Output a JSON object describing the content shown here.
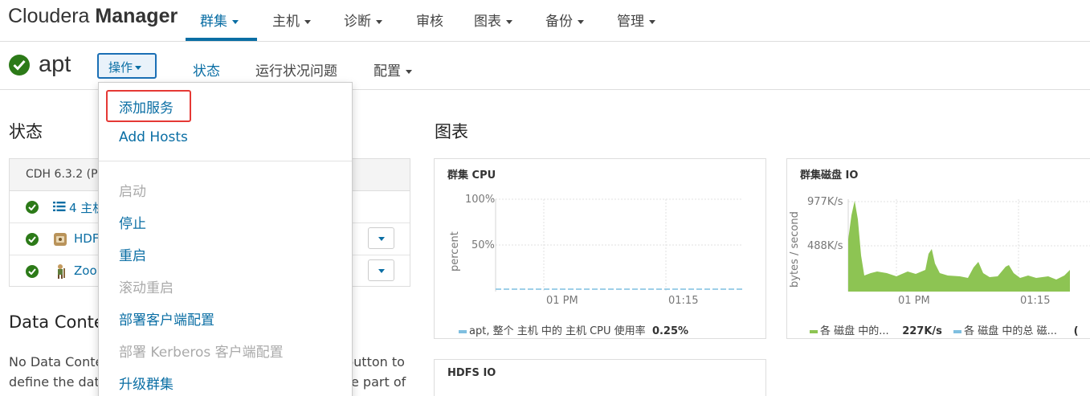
{
  "app": {
    "brand_light": "Cloudera",
    "brand_bold": "Manager"
  },
  "topnav": {
    "items": [
      {
        "label": "群集",
        "active": true
      },
      {
        "label": "主机"
      },
      {
        "label": "诊断"
      },
      {
        "label": "审核"
      },
      {
        "label": "图表"
      },
      {
        "label": "备份"
      },
      {
        "label": "管理"
      }
    ]
  },
  "cluster": {
    "name": "apt",
    "actions_label": "操作",
    "tabs": [
      {
        "label": "状态"
      },
      {
        "label": "运行状况问题"
      },
      {
        "label": "配置"
      }
    ]
  },
  "status": {
    "heading": "状态",
    "version": "CDH 6.3.2 (P",
    "rows": [
      {
        "label": "4 主机",
        "icon": "list-icon"
      },
      {
        "label": "HDF",
        "icon": "hdfs-icon"
      },
      {
        "label": "Zoo",
        "icon": "zookeeper-icon"
      }
    ]
  },
  "data_context": {
    "heading": "Data Conte",
    "line1_left": "No Data Conte",
    "line1_right": "button to",
    "line2_left": "define the data",
    "line2_right": "e part of"
  },
  "charts": {
    "heading": "图表",
    "cpu": {
      "title": "群集 CPU",
      "ylabel": "percent",
      "yticks": [
        "100%",
        "50%"
      ],
      "xticks": [
        "01 PM",
        "01:15"
      ],
      "legend_label": "apt, 整个 主机 中的 主机 CPU 使用率",
      "legend_value": "0.25%"
    },
    "disk": {
      "title": "群集磁盘 IO",
      "ylabel": "bytes / second",
      "yticks": [
        "977K/s",
        "488K/s"
      ],
      "xticks": [
        "01 PM",
        "01:15"
      ],
      "legend1_label": "各 磁盘 中的...",
      "legend1_value": "227K/s",
      "legend2_label": "各 磁盘 中的总 磁...",
      "legend2_value": "(",
      "fill_color": "#8dc453"
    },
    "hdfs": {
      "title": "HDFS IO"
    }
  },
  "dropdown": {
    "items": [
      {
        "label": "添加服务",
        "enabled": true,
        "highlighted": true
      },
      {
        "label": "Add Hosts",
        "enabled": true
      },
      {
        "label": "启动",
        "enabled": false
      },
      {
        "label": "停止",
        "enabled": true
      },
      {
        "label": "重启",
        "enabled": true
      },
      {
        "label": "滚动重启",
        "enabled": false
      },
      {
        "label": "部署客户端配置",
        "enabled": true
      },
      {
        "label": "部署 Kerberos 客户端配置",
        "enabled": false
      },
      {
        "label": "升级群集",
        "enabled": true
      }
    ]
  },
  "colors": {
    "accent": "#0a6ea4",
    "ok_green": "#2c7a18",
    "highlight": "#e53935"
  }
}
